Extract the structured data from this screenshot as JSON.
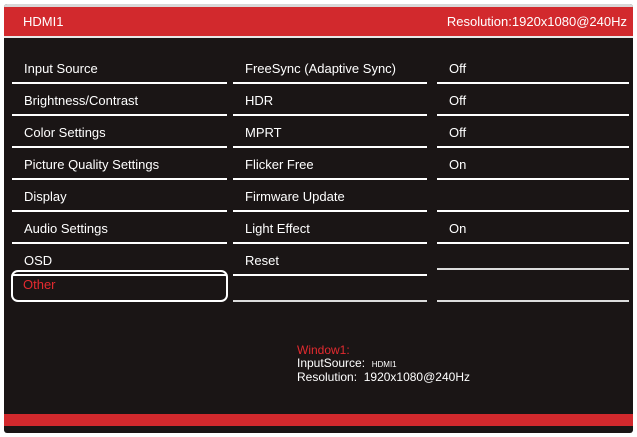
{
  "header": {
    "source": "HDMI1",
    "resolution": "Resolution:1920x1080@240Hz"
  },
  "menu": [
    {
      "label": "Input Source"
    },
    {
      "label": "Brightness/Contrast"
    },
    {
      "label": "Color Settings"
    },
    {
      "label": "Picture Quality Settings"
    },
    {
      "label": "Display"
    },
    {
      "label": "Audio Settings"
    },
    {
      "label": "OSD"
    },
    {
      "label": "Other",
      "selected": true
    }
  ],
  "submenu": [
    {
      "label": "FreeSync (Adaptive Sync)",
      "value": "Off"
    },
    {
      "label": "HDR",
      "value": "Off"
    },
    {
      "label": "MPRT",
      "value": "Off"
    },
    {
      "label": "Flicker Free",
      "value": "On"
    },
    {
      "label": "Firmware Update",
      "value": ""
    },
    {
      "label": "Light Effect",
      "value": "On"
    },
    {
      "label": "Reset",
      "value": ""
    }
  ],
  "info": {
    "window_title": "Window1:",
    "input_label": "InputSource:",
    "input_value": "HDMI1",
    "resolution_label": "Resolution:",
    "resolution_value": "1920x1080@240Hz"
  },
  "colors": {
    "accent": "#d2292d",
    "background": "#1a1515",
    "text": "#ffffff"
  }
}
